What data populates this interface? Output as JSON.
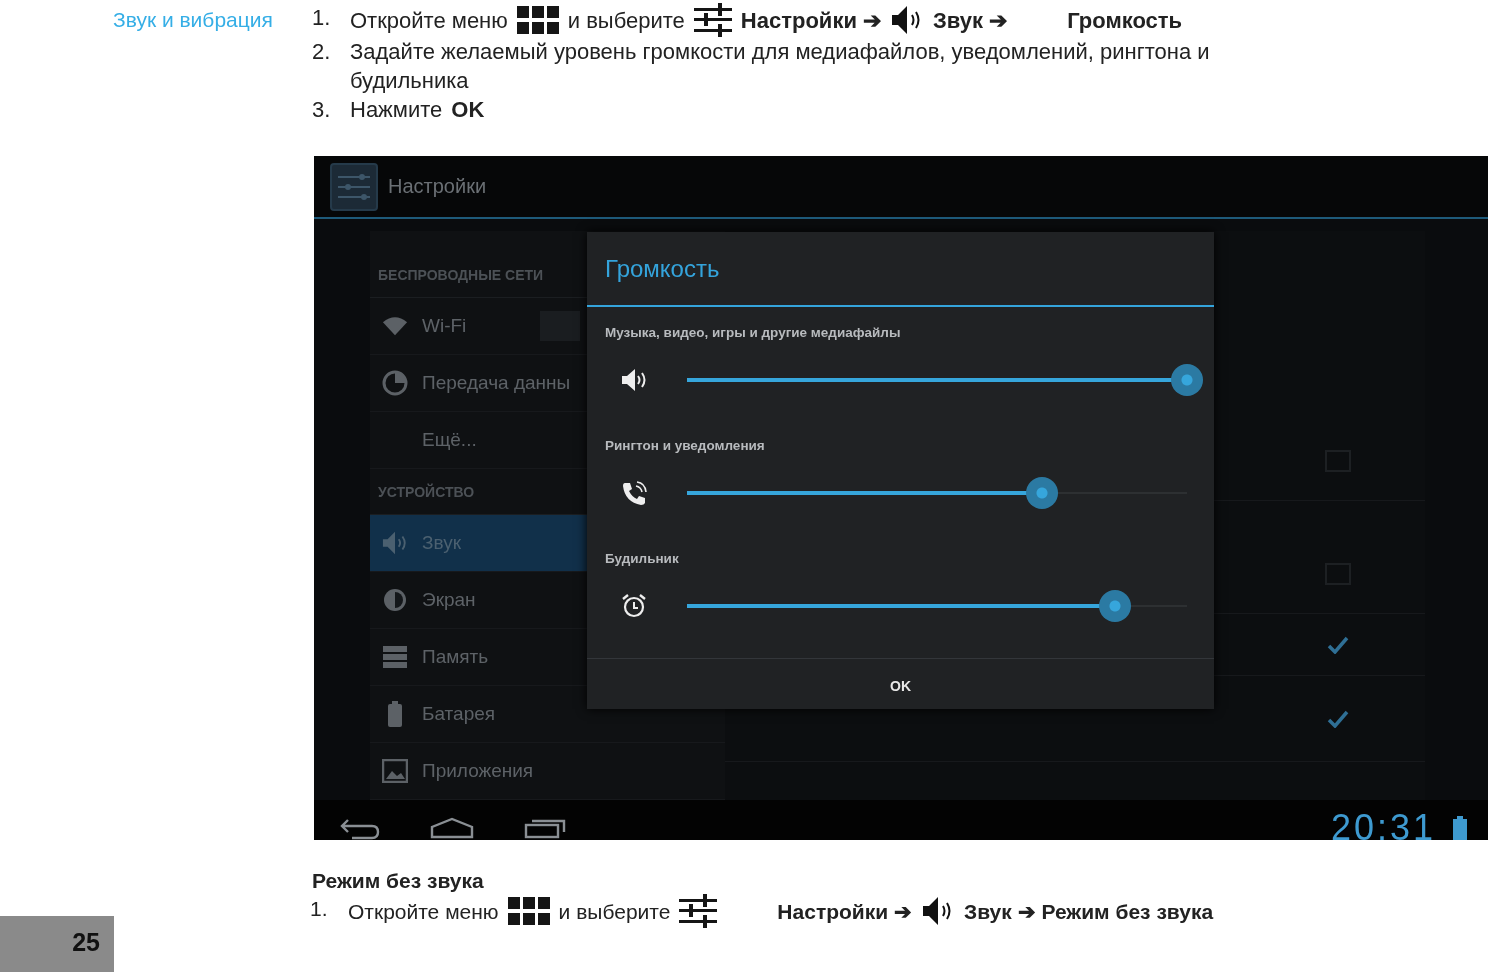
{
  "section_title": "Звук и вибрация",
  "steps": [
    {
      "number": "1.",
      "segments": [
        {
          "kind": "text",
          "text": "Откройте меню"
        },
        {
          "kind": "grid"
        },
        {
          "kind": "text",
          "text": "и выберите"
        },
        {
          "kind": "sliders"
        },
        {
          "kind": "strong",
          "text": "Настройки ➔"
        },
        {
          "kind": "speaker"
        },
        {
          "kind": "strong",
          "text": "Звук ➔"
        },
        {
          "kind": "gap"
        },
        {
          "kind": "strong",
          "text": "Громкость"
        }
      ]
    },
    {
      "number": "2.",
      "segments": [
        {
          "kind": "text",
          "text": "Задайте желаемый уровень громкости для медиафайлов, уведомлений, рингтона и будильника"
        }
      ]
    },
    {
      "number": "3.",
      "segments": [
        {
          "kind": "text",
          "text": "Нажмите"
        },
        {
          "kind": "strong",
          "text": "OK"
        }
      ]
    }
  ],
  "screen": {
    "app_bar": {
      "title": "Настройки"
    },
    "sidebar": [
      {
        "header": "БЕСПРОВОДНЫЕ СЕТИ",
        "items": [
          {
            "label": "Wi-Fi",
            "selected": false
          },
          {
            "label": "Передача данны",
            "selected": false
          },
          {
            "label": "Ещё...",
            "selected": false
          }
        ]
      },
      {
        "header": "УСТРОЙСТВО",
        "items": [
          {
            "label": "Звук",
            "selected": true
          },
          {
            "label": "Экран",
            "selected": false
          },
          {
            "label": "Память",
            "selected": false
          },
          {
            "label": "Батарея",
            "selected": false
          },
          {
            "label": "Приложения",
            "selected": false
          }
        ]
      }
    ],
    "checkboxes": [
      {
        "checked": false
      },
      {
        "checked": false
      },
      {
        "checked": true
      },
      {
        "checked": true
      }
    ],
    "dialog": {
      "title": "Громкость",
      "sliders": [
        {
          "label": "Музыка, видео, игры и другие медиафайлы",
          "level": 1.0
        },
        {
          "label": "Рингтон и уведомления",
          "level": 0.71
        },
        {
          "label": "Будильник",
          "level": 0.855
        }
      ],
      "button": "OK"
    },
    "clock": "20:31"
  },
  "silent_title": "Режим без звука",
  "silent_steps": [
    {
      "number": "1.",
      "segments": [
        {
          "kind": "text",
          "text": "Откройте меню"
        },
        {
          "kind": "grid"
        },
        {
          "kind": "text",
          "text": "и выберите"
        },
        {
          "kind": "sliders"
        },
        {
          "kind": "gap"
        },
        {
          "kind": "strong",
          "text": "Настройки ➔"
        },
        {
          "kind": "speaker"
        },
        {
          "kind": "strong",
          "text": "Звук ➔ Режим без звука"
        }
      ]
    }
  ],
  "page_number": "25"
}
